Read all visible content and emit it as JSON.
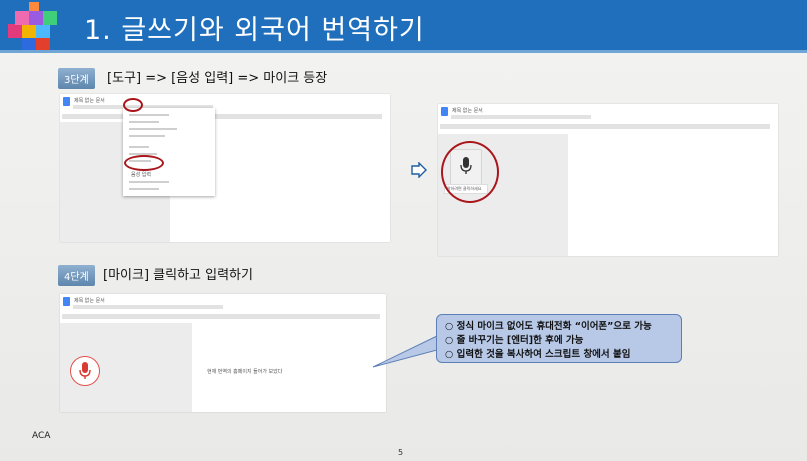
{
  "title": {
    "text": "1. 글쓰기와 외국어 번역하기"
  },
  "step3": {
    "badge": "3단계",
    "instruction": "[도구] => [음성 입력] => 마이크 등장",
    "doc_name": "제목 없는 문서",
    "menu_items_highlight": "음성 입력",
    "mic_tooltip": "말하려면 클릭하세요"
  },
  "step4": {
    "badge": "4단계",
    "instruction": "[마이크] 클릭하고 입력하기",
    "doc_name": "제목 없는 문서",
    "typed_text": "현재 번역의 홈페이지 들어가 보았다"
  },
  "callout": {
    "items": [
      "○ 정식 마이크 없어도 휴대전화 “이어폰”으로 가능",
      "○ 줄 바꾸기는 [엔터]한 후에 가능",
      "○ 입력한 것을 복사하여 스크립트 창에서 붙임"
    ]
  },
  "footer": {
    "left": "ACA",
    "page": "5"
  },
  "colors": {
    "title_bar": "#1f6fbd",
    "accent_red": "#a8161b",
    "callout_bg": "#b8c9e8"
  },
  "icons": [
    "cube-logo-icon",
    "google-docs-icon",
    "microphone-icon",
    "right-arrow-icon"
  ]
}
